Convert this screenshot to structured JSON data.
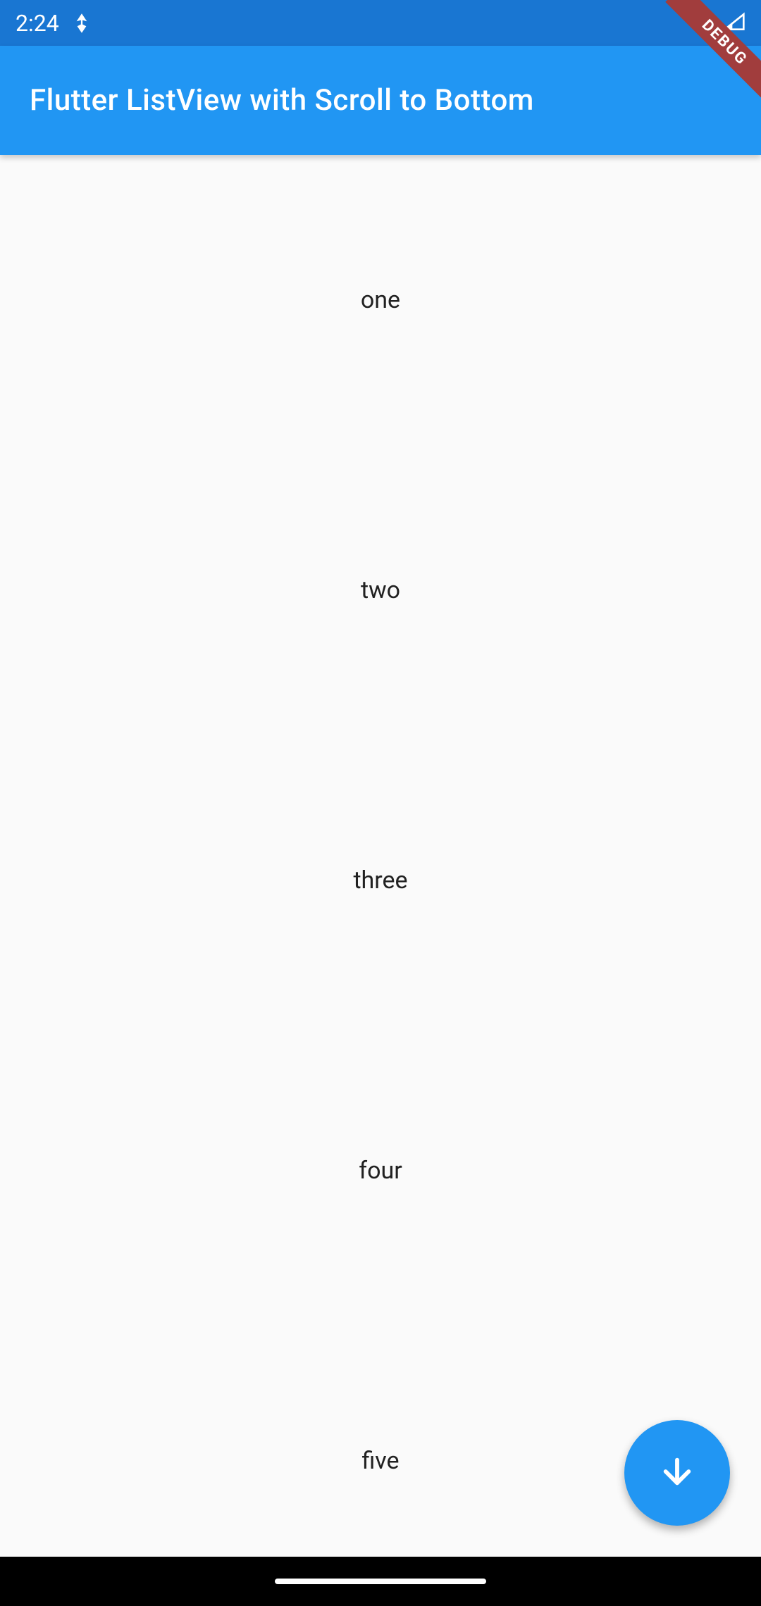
{
  "statusBar": {
    "time": "2:24"
  },
  "appBar": {
    "title": "Flutter ListView with Scroll to Bottom"
  },
  "debugBanner": {
    "label": "DEBUG"
  },
  "list": {
    "items": [
      {
        "label": "one"
      },
      {
        "label": "two"
      },
      {
        "label": "three"
      },
      {
        "label": "four"
      },
      {
        "label": "five"
      }
    ]
  },
  "colors": {
    "primary": "#2196F3",
    "primaryDark": "#1976D2",
    "background": "#FAFAFA"
  }
}
